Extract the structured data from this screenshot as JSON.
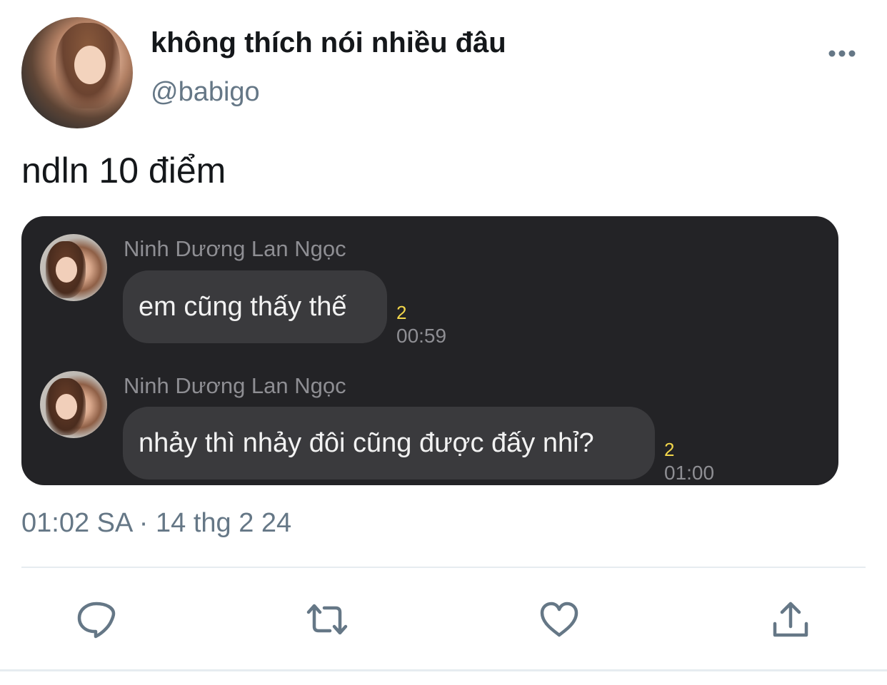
{
  "tweet": {
    "display_name": "không thích nói nhiều đâu",
    "handle": "@babigo",
    "text": "ndln 10 điểm",
    "timestamp": "01:02 SA · 14 thg 2 24"
  },
  "chat": {
    "messages": [
      {
        "sender": "Ninh Dương Lan Ngọc",
        "text": "em cũng thấy thế",
        "read_count": "2",
        "time": "00:59"
      },
      {
        "sender": "Ninh Dương Lan Ngọc",
        "text": "nhảy thì nhảy đôi cũng được đấy nhỉ?",
        "read_count": "2",
        "time": "01:00"
      }
    ]
  },
  "actions": {
    "reply_icon": "speech-bubble-icon",
    "retweet_icon": "retweet-arrows-icon",
    "like_icon": "heart-icon",
    "share_icon": "share-upload-icon"
  },
  "colors": {
    "primary_text": "#14171a",
    "secondary_text": "#657786",
    "chat_background": "#232326",
    "chat_bubble": "#3a3a3d",
    "read_count": "#f2d64b"
  }
}
